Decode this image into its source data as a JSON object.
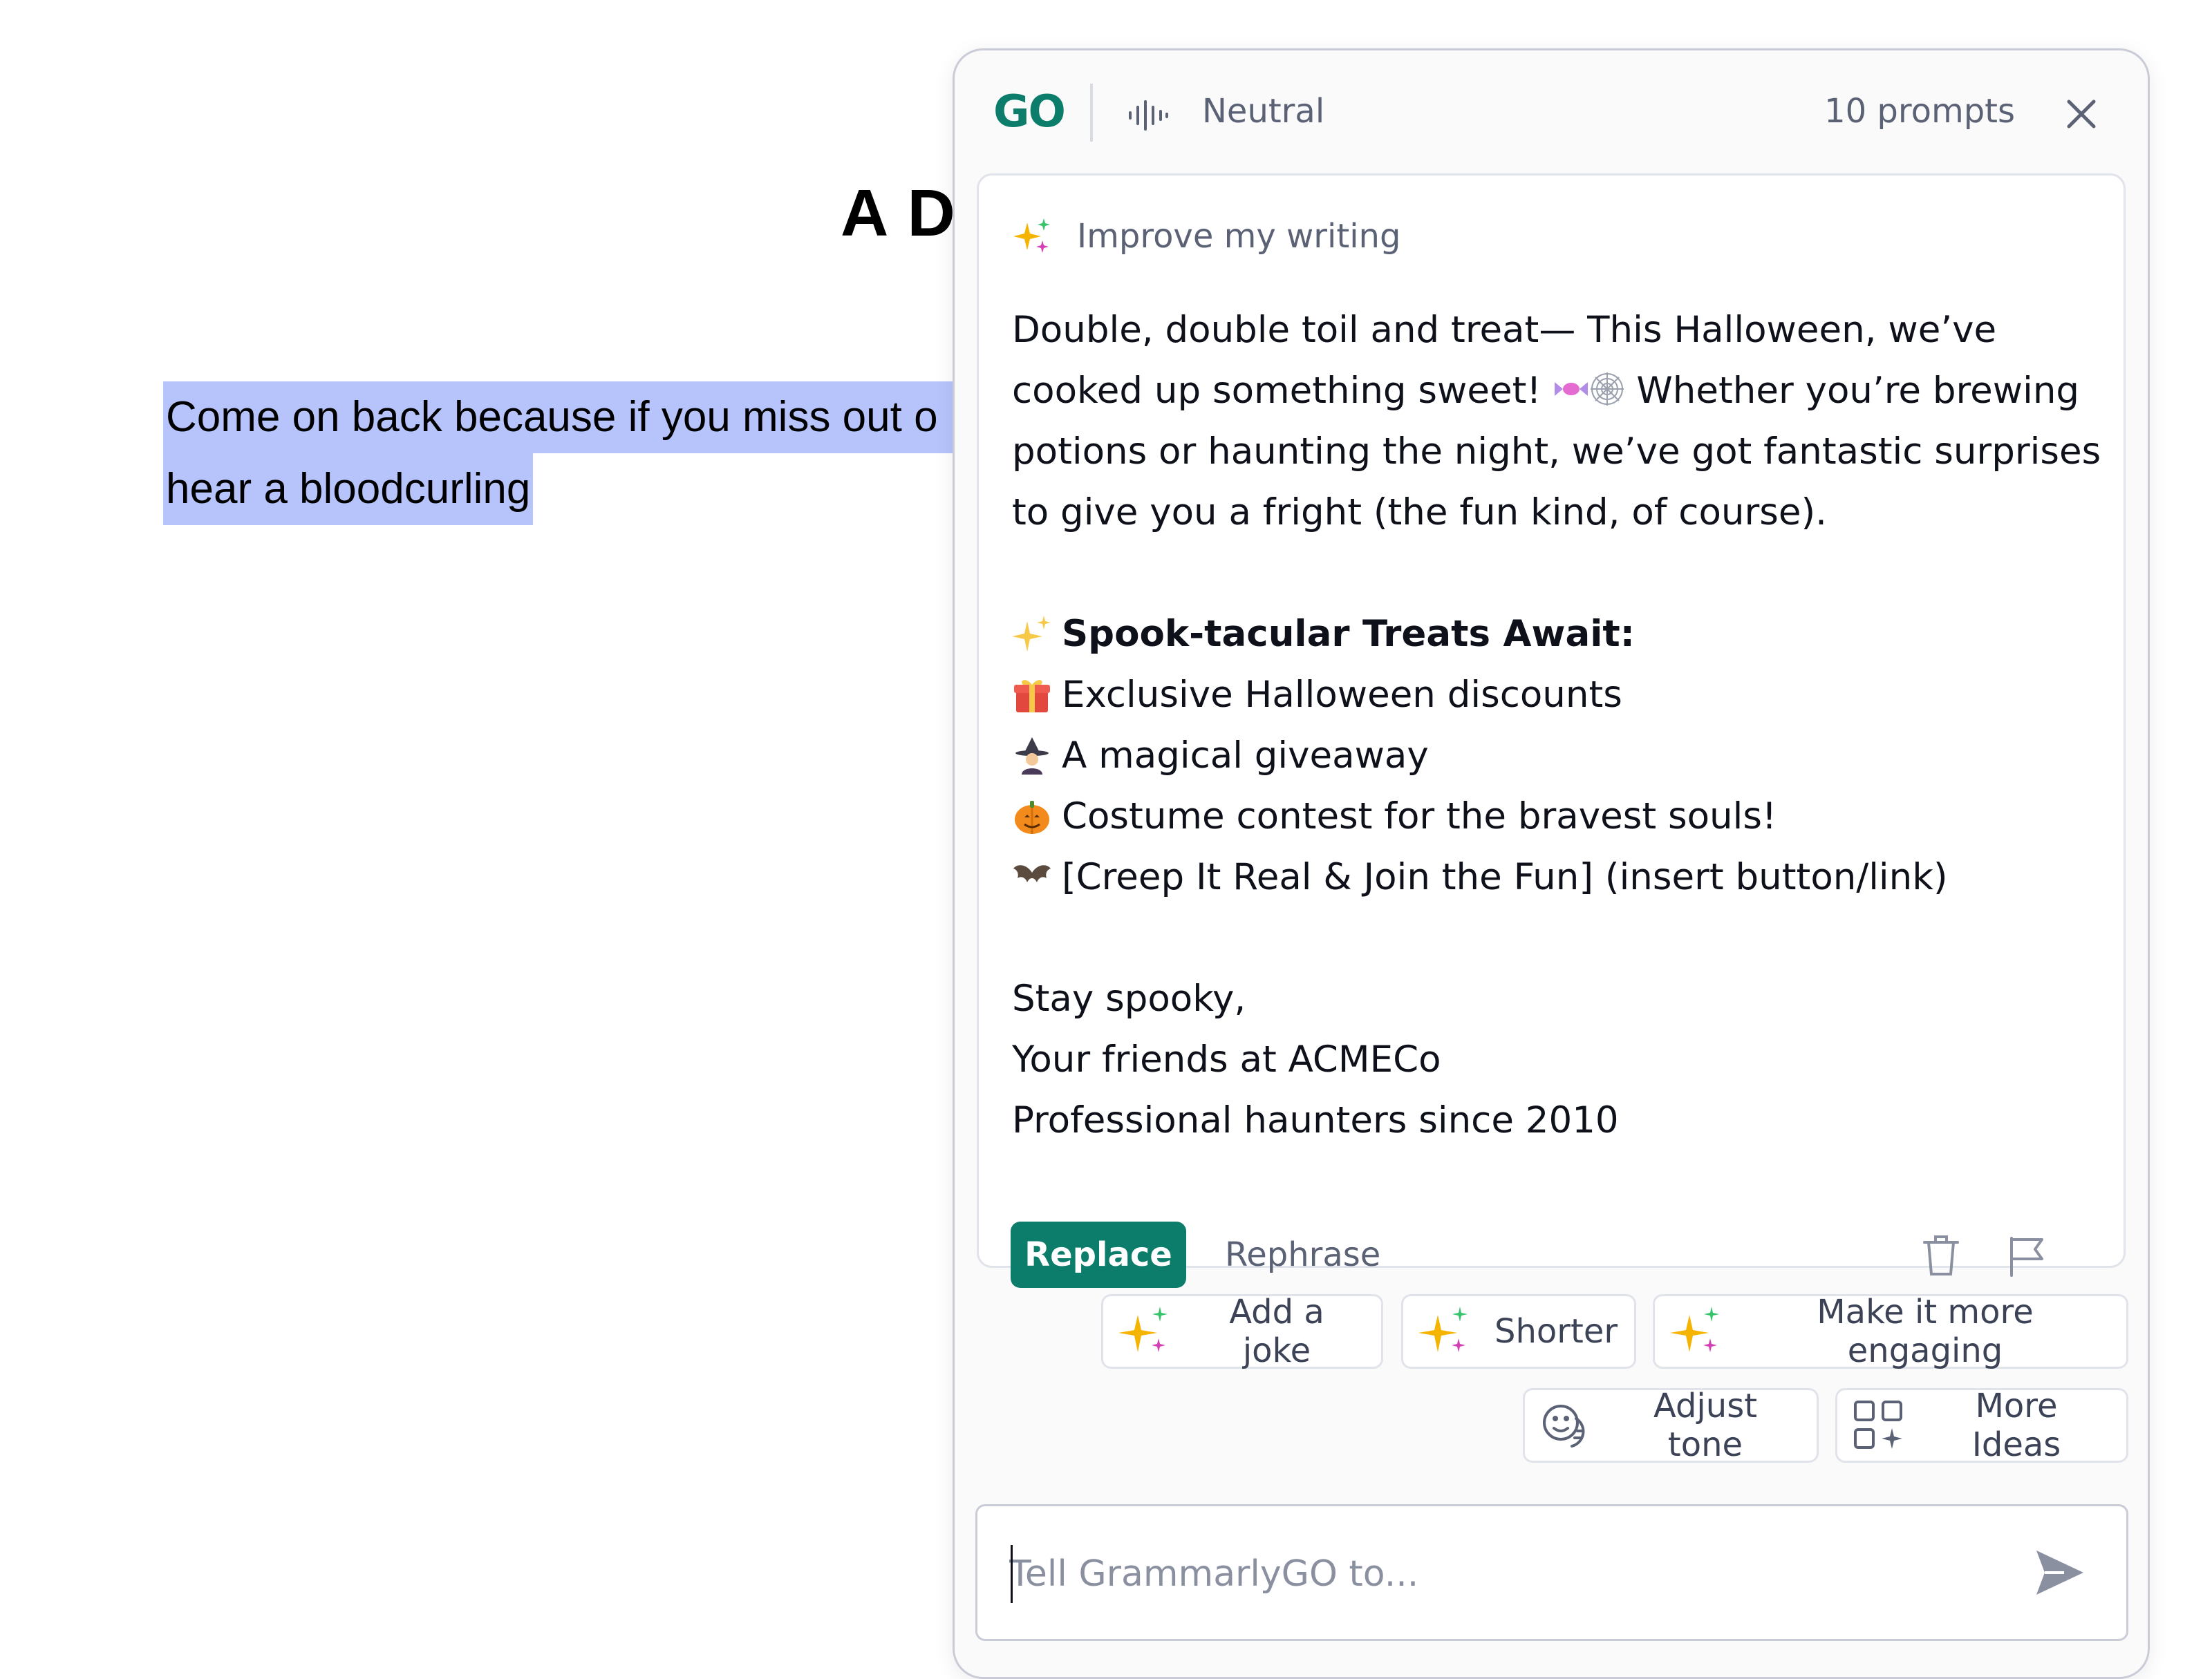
{
  "document": {
    "title_partial": "A D",
    "selected_line_1": "Come on back because if you miss out o",
    "selected_line_2": "hear a bloodcurling"
  },
  "header": {
    "logo": "GO",
    "tone": "Neutral",
    "prompts": "10 prompts"
  },
  "card": {
    "prompt_label": "Improve my writing",
    "intro_part1": "Double, double toil and treat— This Halloween, we’ve cooked up something sweet!",
    "intro_part2": "Whether you’re brewing potions or haunting the night, we’ve got fantastic surprises to give you a fright (the fun kind, of course).",
    "heading": "Spook-tacular Treats Await:",
    "items": [
      "Exclusive Halloween discounts",
      "A magical giveaway",
      "Costume contest for the bravest souls!",
      "[Creep It Real & Join the Fun] (insert button/link)"
    ],
    "signoff": "Stay spooky,",
    "from": "Your friends at ACMECo",
    "tagline": "Professional haunters since 2010",
    "replace_label": "Replace",
    "rephrase_label": "Rephrase"
  },
  "chips": {
    "add_joke": "Add a joke",
    "shorter": "Shorter",
    "engaging": "Make it more engaging",
    "adjust_tone": "Adjust tone",
    "more_ideas": "More Ideas"
  },
  "input": {
    "placeholder": "Tell GrammarlyGO to..."
  },
  "colors": {
    "brand": "#0b7d6a",
    "selection": "#b7c4fb",
    "muted_text": "#5b6275"
  }
}
